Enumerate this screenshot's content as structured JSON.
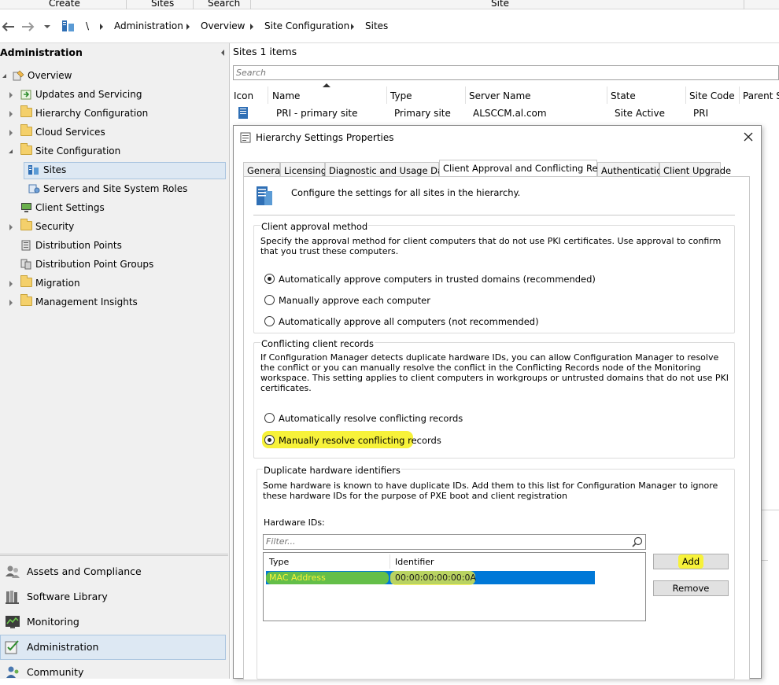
{
  "ribbon": {
    "groups": [
      "Create",
      "Sites",
      "Search",
      "Site"
    ]
  },
  "navbar": {
    "root": "\\",
    "crumbs": [
      "Administration",
      "Overview",
      "Site Configuration",
      "Sites"
    ]
  },
  "sidebar": {
    "title": "Administration",
    "tree": [
      {
        "label": "Overview"
      },
      {
        "label": "Updates and Servicing"
      },
      {
        "label": "Hierarchy Configuration"
      },
      {
        "label": "Cloud Services"
      },
      {
        "label": "Site Configuration"
      },
      {
        "label": "Sites"
      },
      {
        "label": "Servers and Site System Roles"
      },
      {
        "label": "Client Settings"
      },
      {
        "label": "Security"
      },
      {
        "label": "Distribution Points"
      },
      {
        "label": "Distribution Point Groups"
      },
      {
        "label": "Migration"
      },
      {
        "label": "Management Insights"
      }
    ],
    "workspaces": [
      {
        "label": "Assets and Compliance"
      },
      {
        "label": "Software Library"
      },
      {
        "label": "Monitoring"
      },
      {
        "label": "Administration"
      },
      {
        "label": "Community"
      }
    ]
  },
  "list": {
    "title": "Sites 1 items",
    "search_placeholder": "Search",
    "columns": [
      "Icon",
      "Name",
      "Type",
      "Server Name",
      "State",
      "Site Code",
      "Parent Si"
    ],
    "rows": [
      {
        "name": "PRI - primary site",
        "type": "Primary site",
        "server": "ALSCCM.al.com",
        "state": "Site Active",
        "code": "PRI"
      }
    ]
  },
  "dialog": {
    "title": "Hierarchy Settings Properties",
    "tabs": [
      "General",
      "Licensing",
      "Diagnostic and Usage Data",
      "Client Approval and Conflicting Records",
      "Authentication",
      "Client Upgrade"
    ],
    "header_text": "Configure the settings for all sites in the hierarchy.",
    "approval": {
      "title": "Client approval method",
      "description": "Specify the approval method for client computers that do not use PKI certificates. Use approval to confirm that you trust these computers.",
      "options": [
        "Automatically approve computers in trusted domains (recommended)",
        "Manually approve each computer",
        "Automatically approve all computers (not recommended)"
      ]
    },
    "conflicting": {
      "title": "Conflicting client records",
      "description": "If Configuration Manager detects duplicate hardware IDs, you can allow Configuration Manager to resolve the conflict or you can manually resolve the conflict in the Conflicting Records node of the Monitoring workspace. This setting applies to client computers in workgroups or untrusted domains that do not use PKI certificates.",
      "options": [
        "Automatically resolve conflicting records",
        "Manually resolve conflicting records"
      ]
    },
    "duplicates": {
      "title": "Duplicate hardware identifiers",
      "description": "Some hardware is known to have duplicate IDs. Add them to this list for Configuration Manager to ignore these hardware IDs for the purpose of PXE boot and client registration",
      "list_label": "Hardware IDs:",
      "filter_placeholder": "Filter...",
      "columns": [
        "Type",
        "Identifier"
      ],
      "rows": [
        {
          "type": "MAC Address",
          "identifier": "00:00:00:00:00:0A"
        }
      ],
      "add_label": "Add",
      "remove_label": "Remove"
    }
  },
  "colors": {
    "selection_blue": "#0078d7",
    "highlight_yellow": "#f7f23a",
    "highlight_green": "#6fc63a",
    "folder": "#f4d06b"
  }
}
